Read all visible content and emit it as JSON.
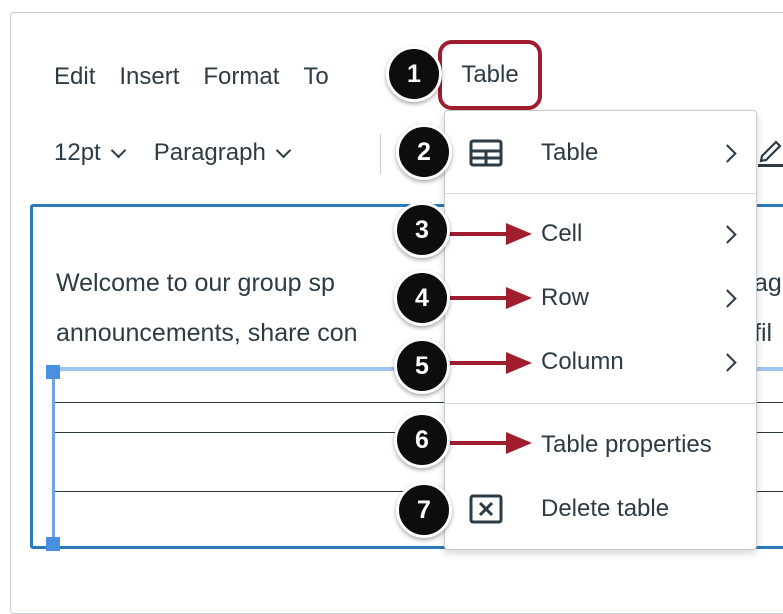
{
  "menubar": {
    "items": [
      "Edit",
      "Insert",
      "Format",
      "To"
    ],
    "table_label": "Table"
  },
  "toolbar": {
    "font_size": "12pt",
    "block_format": "Paragraph"
  },
  "editor": {
    "line1": "Welcome to our group sp",
    "line2": "announcements, share con",
    "line1_right": "ag",
    "line2_right": "fil"
  },
  "dropdown": {
    "items": [
      {
        "label": "Table",
        "icon": "table-grid-icon",
        "submenu": true
      },
      {
        "label": "Cell",
        "submenu": true
      },
      {
        "label": "Row",
        "submenu": true
      },
      {
        "label": "Column",
        "submenu": true
      },
      {
        "label": "Table properties",
        "submenu": false
      },
      {
        "label": "Delete table",
        "icon": "delete-table-icon",
        "submenu": false
      }
    ]
  },
  "callouts": [
    "1",
    "2",
    "3",
    "4",
    "5",
    "6",
    "7"
  ],
  "colors": {
    "accent_red": "#a01d2e",
    "editor_focus_blue": "#2b7abc",
    "text": "#2d3b45"
  }
}
